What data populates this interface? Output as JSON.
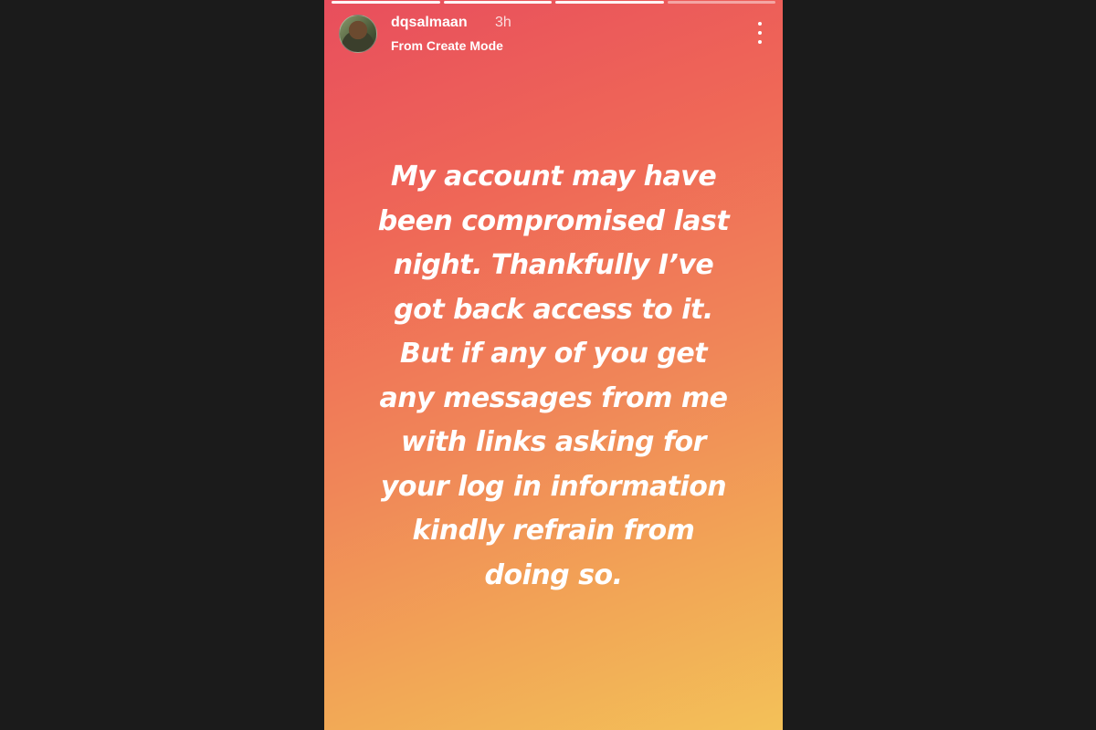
{
  "story": {
    "username": "dqsalmaan",
    "time": "3h",
    "subtitle": "From Create Mode",
    "avatar_icon": "profile-avatar",
    "menu_icon": "more-vertical-icon",
    "progress": {
      "segments": 4,
      "completed": 3
    },
    "colors": {
      "gradient_top": "#e84e5d",
      "gradient_bottom": "#f3c158",
      "background": "#1b1b1b"
    },
    "message_lines": [
      "My account may have",
      "been compromised last",
      "night. Thankfully I’ve",
      "got back access to it.",
      "But if any of you get",
      "any messages from me",
      "with links asking for",
      "your log in information",
      "kindly refrain from",
      "doing so."
    ]
  }
}
